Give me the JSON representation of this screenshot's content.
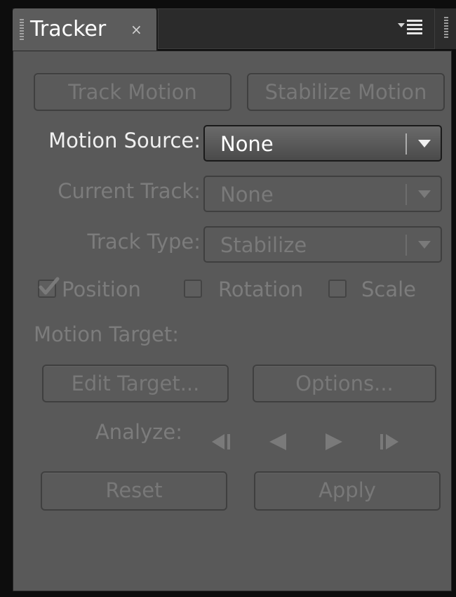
{
  "tab": {
    "title": "Tracker",
    "close_glyph": "×",
    "grip_icon": "panel-grip-icon",
    "menu_icon": "panel-menu-icon"
  },
  "buttons": {
    "track_motion": "Track Motion",
    "stabilize_motion": "Stabilize Motion",
    "edit_target": "Edit Target...",
    "options": "Options...",
    "reset": "Reset",
    "apply": "Apply"
  },
  "fields": {
    "motion_source": {
      "label": "Motion Source:",
      "value": "None"
    },
    "current_track": {
      "label": "Current Track:",
      "value": "None"
    },
    "track_type": {
      "label": "Track Type:",
      "value": "Stabilize"
    }
  },
  "checkboxes": {
    "position": {
      "label": "Position",
      "checked": true
    },
    "rotation": {
      "label": "Rotation",
      "checked": false
    },
    "scale": {
      "label": "Scale",
      "checked": false
    }
  },
  "motion_target": {
    "label": "Motion Target:"
  },
  "analyze": {
    "label": "Analyze:",
    "controls": [
      "step-backward-icon",
      "play-backward-icon",
      "play-forward-icon",
      "step-forward-icon"
    ]
  },
  "colors": {
    "panel_bg": "#595959",
    "tab_bg": "#5c5c5c",
    "disabled_text": "#787878",
    "active_text": "#f0f0f0",
    "frame_bg": "#0d0d0d"
  }
}
